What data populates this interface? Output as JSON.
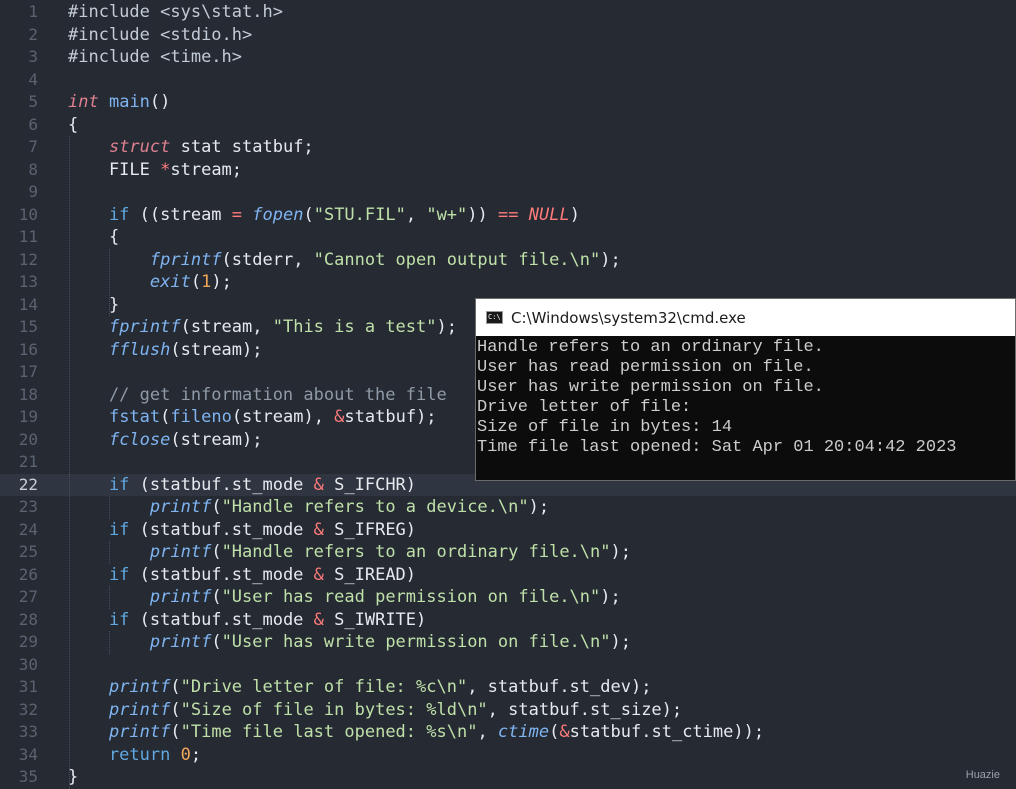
{
  "editor": {
    "current_line": 22,
    "colors": {
      "background": "#252a33",
      "current_line": "#2f3541",
      "keyword": "#61a8e0",
      "string": "#bfe0a8",
      "number": "#f2a65a",
      "operator": "#ff7b7b"
    },
    "lines": [
      [
        [
          "pp",
          "#include "
        ],
        [
          "pp",
          "<sys\\stat.h>"
        ]
      ],
      [
        [
          "pp",
          "#include "
        ],
        [
          "pp",
          "<stdio.h>"
        ]
      ],
      [
        [
          "pp",
          "#include "
        ],
        [
          "pp",
          "<time.h>"
        ]
      ],
      [],
      [
        [
          "type",
          "int"
        ],
        [
          "id",
          " "
        ],
        [
          "fn",
          "main"
        ],
        [
          "id",
          "()"
        ]
      ],
      [
        [
          "id",
          "{"
        ]
      ],
      [
        [
          "id",
          "    "
        ],
        [
          "type",
          "struct"
        ],
        [
          "id",
          " stat statbuf;"
        ]
      ],
      [
        [
          "id",
          "    FILE "
        ],
        [
          "op",
          "*"
        ],
        [
          "id",
          "stream;"
        ]
      ],
      [],
      [
        [
          "kw",
          "    if"
        ],
        [
          "id",
          " ((stream "
        ],
        [
          "op",
          "="
        ],
        [
          "id",
          " "
        ],
        [
          "fni",
          "fopen"
        ],
        [
          "id",
          "("
        ],
        [
          "str",
          "\"STU.FIL\""
        ],
        [
          "id",
          ", "
        ],
        [
          "str",
          "\"w+\""
        ],
        [
          "id",
          ")) "
        ],
        [
          "op",
          "=="
        ],
        [
          "id",
          " "
        ],
        [
          "null",
          "NULL"
        ],
        [
          "id",
          ")"
        ]
      ],
      [
        [
          "id",
          "    {"
        ]
      ],
      [
        [
          "id",
          "        "
        ],
        [
          "fni",
          "fprintf"
        ],
        [
          "id",
          "(stderr, "
        ],
        [
          "str",
          "\"Cannot open output file.\\n\""
        ],
        [
          "id",
          ");"
        ]
      ],
      [
        [
          "id",
          "        "
        ],
        [
          "fni",
          "exit"
        ],
        [
          "id",
          "("
        ],
        [
          "num",
          "1"
        ],
        [
          "id",
          ");"
        ]
      ],
      [
        [
          "id",
          "    }"
        ]
      ],
      [
        [
          "id",
          "    "
        ],
        [
          "fni",
          "fprintf"
        ],
        [
          "id",
          "(stream, "
        ],
        [
          "str",
          "\"This is a test\""
        ],
        [
          "id",
          ");"
        ]
      ],
      [
        [
          "id",
          "    "
        ],
        [
          "fni",
          "fflush"
        ],
        [
          "id",
          "(stream);"
        ]
      ],
      [],
      [
        [
          "cmt",
          "    // get information about the file"
        ]
      ],
      [
        [
          "id",
          "    "
        ],
        [
          "fn",
          "fstat"
        ],
        [
          "id",
          "("
        ],
        [
          "fn",
          "fileno"
        ],
        [
          "id",
          "(stream), "
        ],
        [
          "op",
          "&"
        ],
        [
          "id",
          "statbuf);"
        ]
      ],
      [
        [
          "id",
          "    "
        ],
        [
          "fni",
          "fclose"
        ],
        [
          "id",
          "(stream);"
        ]
      ],
      [],
      [
        [
          "kw",
          "    if"
        ],
        [
          "id",
          " (statbuf.st_mode "
        ],
        [
          "op",
          "&"
        ],
        [
          "id",
          " S_IFCHR)"
        ]
      ],
      [
        [
          "id",
          "        "
        ],
        [
          "fni",
          "printf"
        ],
        [
          "id",
          "("
        ],
        [
          "str",
          "\"Handle refers to a device.\\n\""
        ],
        [
          "id",
          ");"
        ]
      ],
      [
        [
          "kw",
          "    if"
        ],
        [
          "id",
          " (statbuf.st_mode "
        ],
        [
          "op",
          "&"
        ],
        [
          "id",
          " S_IFREG)"
        ]
      ],
      [
        [
          "id",
          "        "
        ],
        [
          "fni",
          "printf"
        ],
        [
          "id",
          "("
        ],
        [
          "str",
          "\"Handle refers to an ordinary file.\\n\""
        ],
        [
          "id",
          ");"
        ]
      ],
      [
        [
          "kw",
          "    if"
        ],
        [
          "id",
          " (statbuf.st_mode "
        ],
        [
          "op",
          "&"
        ],
        [
          "id",
          " S_IREAD)"
        ]
      ],
      [
        [
          "id",
          "        "
        ],
        [
          "fni",
          "printf"
        ],
        [
          "id",
          "("
        ],
        [
          "str",
          "\"User has read permission on file.\\n\""
        ],
        [
          "id",
          ");"
        ]
      ],
      [
        [
          "kw",
          "    if"
        ],
        [
          "id",
          " (statbuf.st_mode "
        ],
        [
          "op",
          "&"
        ],
        [
          "id",
          " S_IWRITE)"
        ]
      ],
      [
        [
          "id",
          "        "
        ],
        [
          "fni",
          "printf"
        ],
        [
          "id",
          "("
        ],
        [
          "str",
          "\"User has write permission on file.\\n\""
        ],
        [
          "id",
          ");"
        ]
      ],
      [],
      [
        [
          "id",
          "    "
        ],
        [
          "fni",
          "printf"
        ],
        [
          "id",
          "("
        ],
        [
          "str",
          "\"Drive letter of file: %c\\n\""
        ],
        [
          "id",
          ", statbuf.st_dev);"
        ]
      ],
      [
        [
          "id",
          "    "
        ],
        [
          "fni",
          "printf"
        ],
        [
          "id",
          "("
        ],
        [
          "str",
          "\"Size of file in bytes: %ld\\n\""
        ],
        [
          "id",
          ", statbuf.st_size);"
        ]
      ],
      [
        [
          "id",
          "    "
        ],
        [
          "fni",
          "printf"
        ],
        [
          "id",
          "("
        ],
        [
          "str",
          "\"Time file last opened: %s\\n\""
        ],
        [
          "id",
          ", "
        ],
        [
          "fni",
          "ctime"
        ],
        [
          "id",
          "("
        ],
        [
          "op",
          "&"
        ],
        [
          "id",
          "statbuf.st_ctime));"
        ]
      ],
      [
        [
          "kw",
          "    return"
        ],
        [
          "id",
          " "
        ],
        [
          "num",
          "0"
        ],
        [
          "id",
          ";"
        ]
      ],
      [
        [
          "id",
          "}"
        ]
      ]
    ]
  },
  "cmd": {
    "title": "C:\\Windows\\system32\\cmd.exe",
    "icon": "cmd-icon",
    "output": [
      "Handle refers to an ordinary file.",
      "User has read permission on file.",
      "User has write permission on file.",
      "Drive letter of file:",
      "Size of file in bytes: 14",
      "Time file last opened: Sat Apr 01 20:04:42 2023"
    ]
  },
  "watermark": "Huazie"
}
